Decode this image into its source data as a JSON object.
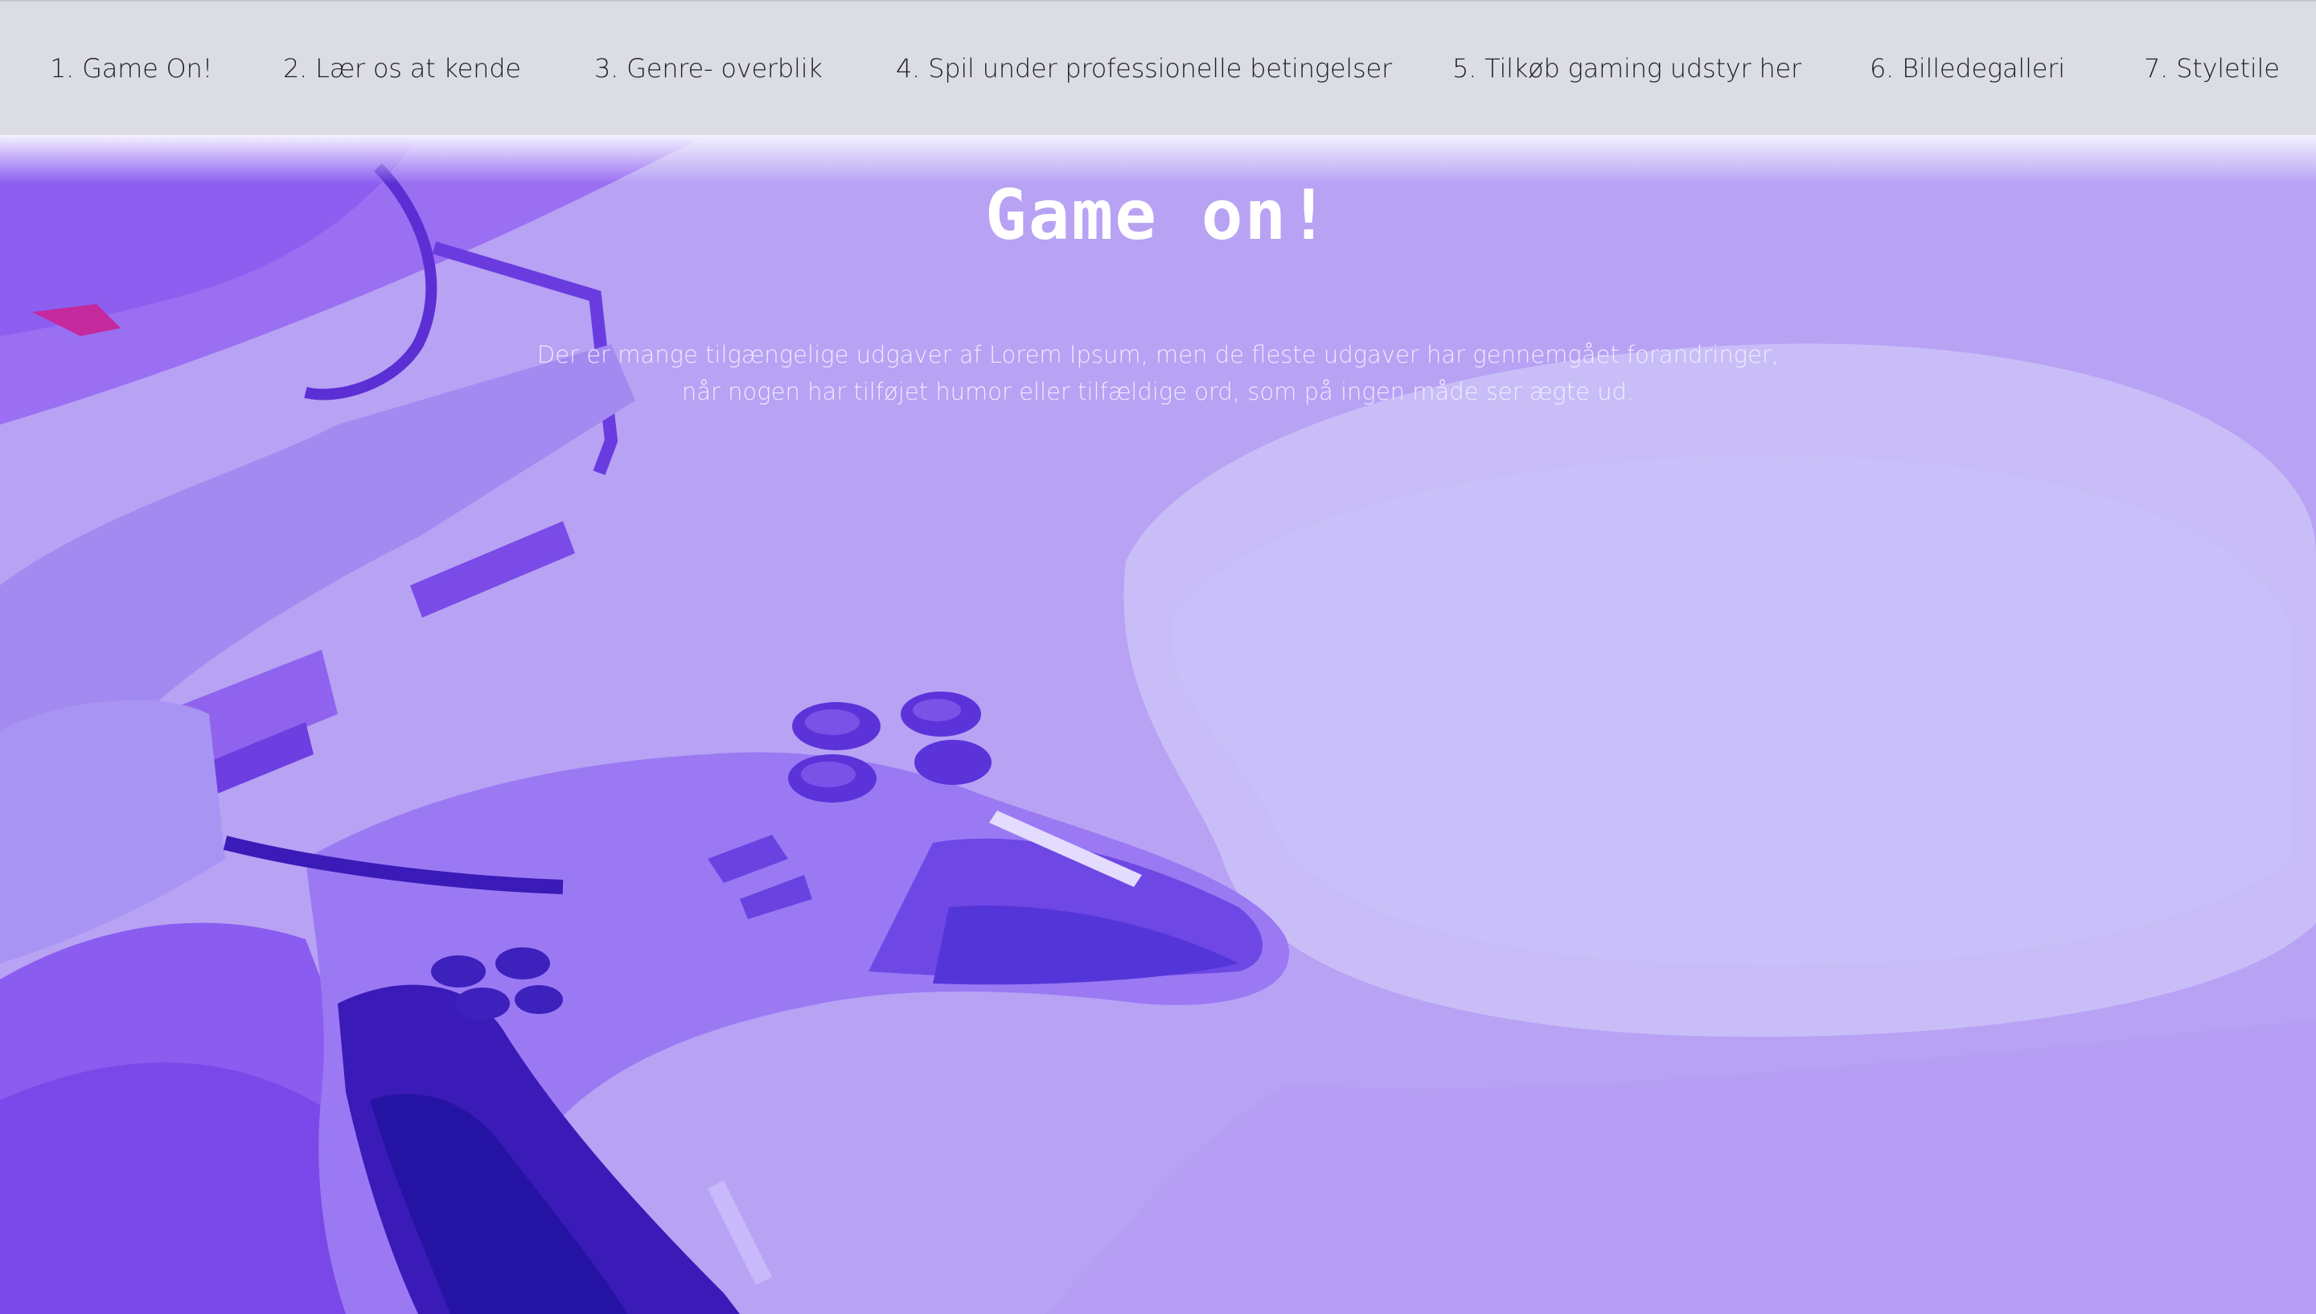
{
  "nav": {
    "items": [
      {
        "label": "1. Game On!"
      },
      {
        "label": "2. Lær os at kende"
      },
      {
        "label": "3. Genre- overblik"
      },
      {
        "label": "4. Spil under professionelle betingelser"
      },
      {
        "label": "5. Tilkøb gaming udstyr her"
      },
      {
        "label": "6. Billedegalleri"
      },
      {
        "label": "7. Styletile"
      }
    ]
  },
  "hero": {
    "title": "Game on!",
    "text_line1": "Der er mange tilgængelige udgaver af Lorem Ipsum, men de fleste udgaver har gennemgået forandringer,",
    "text_line2": "når nogen har tilføjet humor eller tilfældige ord, som på ingen måde ser ægte ud.",
    "image": "game-controller-illustration"
  },
  "colors": {
    "navbar_bg": "#dcdde4",
    "hero_bg": "#b59ff4",
    "accent_dark": "#2a14a8",
    "accent_mid": "#8b5cf0",
    "title_color": "#ffffff"
  }
}
